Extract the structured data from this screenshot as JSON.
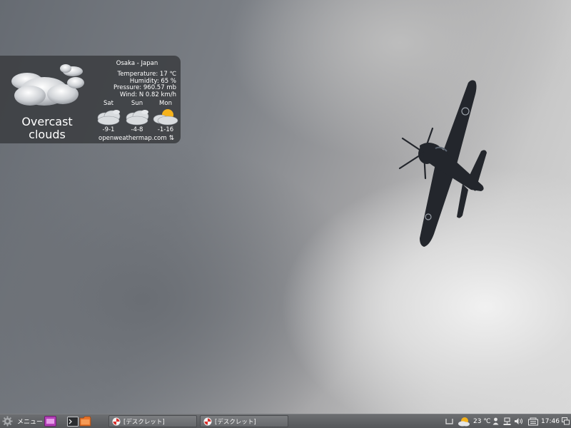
{
  "weather": {
    "condition_line1": "Overcast",
    "condition_line2": "clouds",
    "location": "Osaka - Japan",
    "temperature": "Temperature: 17 ℃",
    "humidity": "Humidity: 65 %",
    "pressure": "Pressure: 960.57 mb",
    "wind": "Wind: N 0.82 km/h",
    "forecast": [
      {
        "day": "Sat",
        "temps": "-9-1",
        "icon": "cloud-icon"
      },
      {
        "day": "Sun",
        "temps": "-4-8",
        "icon": "cloud-icon"
      },
      {
        "day": "Mon",
        "temps": "-1-16",
        "icon": "partly-sunny-icon"
      }
    ],
    "credit": "openweathermap.com",
    "refresh_glyph": "⇅"
  },
  "taskbar": {
    "menu_label": "メニュー",
    "tasks": [
      {
        "label": "[デスクレット]"
      },
      {
        "label": "[デスクレット]"
      }
    ],
    "tray_temp": "23 ℃",
    "clock": "17:46"
  },
  "colors": {
    "widget_bg": "#3a3c40",
    "taskbar_bg": "#5e6063",
    "sun_color": "#f5b21b",
    "folder_color": "#e8732a",
    "app_magenta": "#b13fb5"
  }
}
